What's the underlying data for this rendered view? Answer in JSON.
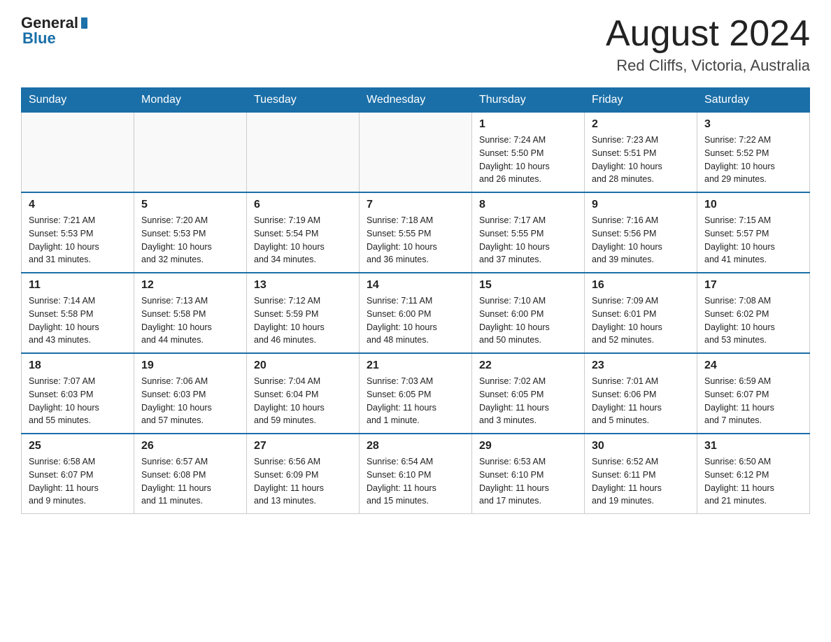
{
  "header": {
    "logo_general": "General",
    "logo_blue": "Blue",
    "month_title": "August 2024",
    "location": "Red Cliffs, Victoria, Australia"
  },
  "days_of_week": [
    "Sunday",
    "Monday",
    "Tuesday",
    "Wednesday",
    "Thursday",
    "Friday",
    "Saturday"
  ],
  "weeks": [
    [
      {
        "day": "",
        "info": ""
      },
      {
        "day": "",
        "info": ""
      },
      {
        "day": "",
        "info": ""
      },
      {
        "day": "",
        "info": ""
      },
      {
        "day": "1",
        "info": "Sunrise: 7:24 AM\nSunset: 5:50 PM\nDaylight: 10 hours\nand 26 minutes."
      },
      {
        "day": "2",
        "info": "Sunrise: 7:23 AM\nSunset: 5:51 PM\nDaylight: 10 hours\nand 28 minutes."
      },
      {
        "day": "3",
        "info": "Sunrise: 7:22 AM\nSunset: 5:52 PM\nDaylight: 10 hours\nand 29 minutes."
      }
    ],
    [
      {
        "day": "4",
        "info": "Sunrise: 7:21 AM\nSunset: 5:53 PM\nDaylight: 10 hours\nand 31 minutes."
      },
      {
        "day": "5",
        "info": "Sunrise: 7:20 AM\nSunset: 5:53 PM\nDaylight: 10 hours\nand 32 minutes."
      },
      {
        "day": "6",
        "info": "Sunrise: 7:19 AM\nSunset: 5:54 PM\nDaylight: 10 hours\nand 34 minutes."
      },
      {
        "day": "7",
        "info": "Sunrise: 7:18 AM\nSunset: 5:55 PM\nDaylight: 10 hours\nand 36 minutes."
      },
      {
        "day": "8",
        "info": "Sunrise: 7:17 AM\nSunset: 5:55 PM\nDaylight: 10 hours\nand 37 minutes."
      },
      {
        "day": "9",
        "info": "Sunrise: 7:16 AM\nSunset: 5:56 PM\nDaylight: 10 hours\nand 39 minutes."
      },
      {
        "day": "10",
        "info": "Sunrise: 7:15 AM\nSunset: 5:57 PM\nDaylight: 10 hours\nand 41 minutes."
      }
    ],
    [
      {
        "day": "11",
        "info": "Sunrise: 7:14 AM\nSunset: 5:58 PM\nDaylight: 10 hours\nand 43 minutes."
      },
      {
        "day": "12",
        "info": "Sunrise: 7:13 AM\nSunset: 5:58 PM\nDaylight: 10 hours\nand 44 minutes."
      },
      {
        "day": "13",
        "info": "Sunrise: 7:12 AM\nSunset: 5:59 PM\nDaylight: 10 hours\nand 46 minutes."
      },
      {
        "day": "14",
        "info": "Sunrise: 7:11 AM\nSunset: 6:00 PM\nDaylight: 10 hours\nand 48 minutes."
      },
      {
        "day": "15",
        "info": "Sunrise: 7:10 AM\nSunset: 6:00 PM\nDaylight: 10 hours\nand 50 minutes."
      },
      {
        "day": "16",
        "info": "Sunrise: 7:09 AM\nSunset: 6:01 PM\nDaylight: 10 hours\nand 52 minutes."
      },
      {
        "day": "17",
        "info": "Sunrise: 7:08 AM\nSunset: 6:02 PM\nDaylight: 10 hours\nand 53 minutes."
      }
    ],
    [
      {
        "day": "18",
        "info": "Sunrise: 7:07 AM\nSunset: 6:03 PM\nDaylight: 10 hours\nand 55 minutes."
      },
      {
        "day": "19",
        "info": "Sunrise: 7:06 AM\nSunset: 6:03 PM\nDaylight: 10 hours\nand 57 minutes."
      },
      {
        "day": "20",
        "info": "Sunrise: 7:04 AM\nSunset: 6:04 PM\nDaylight: 10 hours\nand 59 minutes."
      },
      {
        "day": "21",
        "info": "Sunrise: 7:03 AM\nSunset: 6:05 PM\nDaylight: 11 hours\nand 1 minute."
      },
      {
        "day": "22",
        "info": "Sunrise: 7:02 AM\nSunset: 6:05 PM\nDaylight: 11 hours\nand 3 minutes."
      },
      {
        "day": "23",
        "info": "Sunrise: 7:01 AM\nSunset: 6:06 PM\nDaylight: 11 hours\nand 5 minutes."
      },
      {
        "day": "24",
        "info": "Sunrise: 6:59 AM\nSunset: 6:07 PM\nDaylight: 11 hours\nand 7 minutes."
      }
    ],
    [
      {
        "day": "25",
        "info": "Sunrise: 6:58 AM\nSunset: 6:07 PM\nDaylight: 11 hours\nand 9 minutes."
      },
      {
        "day": "26",
        "info": "Sunrise: 6:57 AM\nSunset: 6:08 PM\nDaylight: 11 hours\nand 11 minutes."
      },
      {
        "day": "27",
        "info": "Sunrise: 6:56 AM\nSunset: 6:09 PM\nDaylight: 11 hours\nand 13 minutes."
      },
      {
        "day": "28",
        "info": "Sunrise: 6:54 AM\nSunset: 6:10 PM\nDaylight: 11 hours\nand 15 minutes."
      },
      {
        "day": "29",
        "info": "Sunrise: 6:53 AM\nSunset: 6:10 PM\nDaylight: 11 hours\nand 17 minutes."
      },
      {
        "day": "30",
        "info": "Sunrise: 6:52 AM\nSunset: 6:11 PM\nDaylight: 11 hours\nand 19 minutes."
      },
      {
        "day": "31",
        "info": "Sunrise: 6:50 AM\nSunset: 6:12 PM\nDaylight: 11 hours\nand 21 minutes."
      }
    ]
  ]
}
